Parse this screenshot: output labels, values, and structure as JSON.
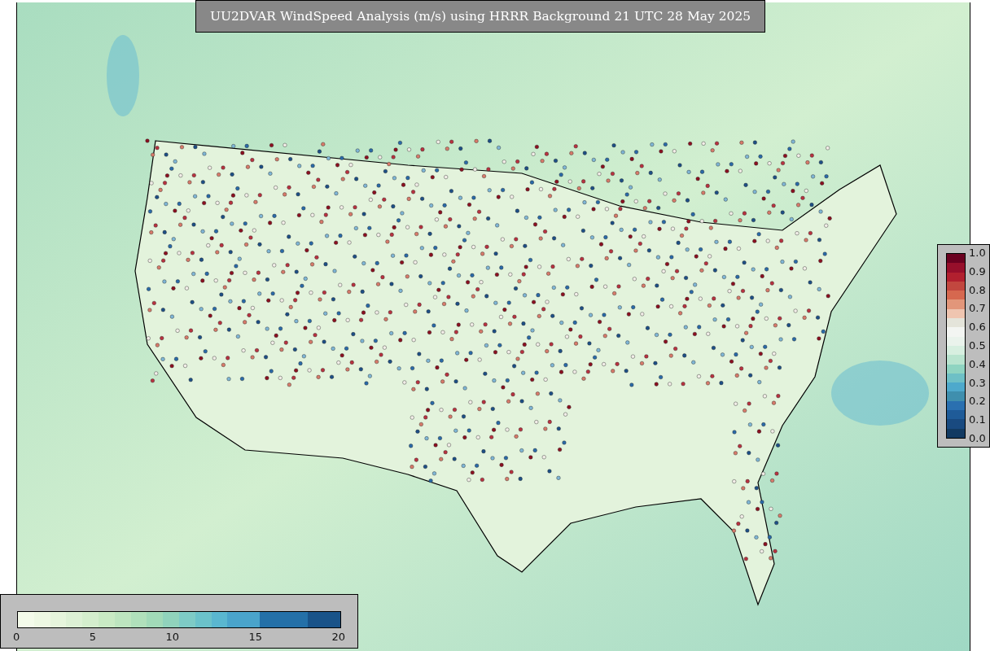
{
  "title": "UU2DVAR WindSpeed Analysis (m/s) using HRRR Background 21 UTC 28 May 2025",
  "ratio_colorbar": {
    "labels": [
      "1.0",
      "0.9",
      "0.8",
      "0.7",
      "0.6",
      "0.5",
      "0.4",
      "0.3",
      "0.2",
      "0.1",
      "0.0"
    ],
    "steps": [
      {
        "color": "#6b0020"
      },
      {
        "color": "#970f2b"
      },
      {
        "color": "#b2202f"
      },
      {
        "color": "#c2473f"
      },
      {
        "color": "#d6684f"
      },
      {
        "color": "#e2967a"
      },
      {
        "color": "#efc5b0"
      },
      {
        "color": "#e4e4da"
      },
      {
        "color": "#f3f5f2"
      },
      {
        "color": "#eaf3ec"
      },
      {
        "color": "#d7efe0"
      },
      {
        "color": "#b9e4cf"
      },
      {
        "color": "#8fd4c1"
      },
      {
        "color": "#6ec0c6"
      },
      {
        "color": "#4ea9cc"
      },
      {
        "color": "#3f8fae"
      },
      {
        "color": "#2a70b0"
      },
      {
        "color": "#1f5b98"
      },
      {
        "color": "#194a80"
      },
      {
        "color": "#123a62"
      }
    ]
  },
  "speed_colorbar": {
    "labels": [
      "0",
      "5",
      "10",
      "15",
      "20"
    ],
    "steps": [
      {
        "color": "#f4fbea"
      },
      {
        "color": "#eef8e3"
      },
      {
        "color": "#e6f5dc"
      },
      {
        "color": "#ddf1d5"
      },
      {
        "color": "#d4eecd"
      },
      {
        "color": "#c9eac4"
      },
      {
        "color": "#bde5bf"
      },
      {
        "color": "#b0e0bb"
      },
      {
        "color": "#a1dab8"
      },
      {
        "color": "#90d3bc"
      },
      {
        "color": "#7ecbc6"
      },
      {
        "color": "#6bc2ca"
      },
      {
        "color": "#5ab7d0"
      },
      {
        "color": "#4aa4cb"
      },
      {
        "color": "#4aa4cb"
      },
      {
        "color": "#2470a8"
      },
      {
        "color": "#2470a8"
      },
      {
        "color": "#2470a8"
      },
      {
        "color": "#195389"
      },
      {
        "color": "#195389"
      }
    ]
  }
}
